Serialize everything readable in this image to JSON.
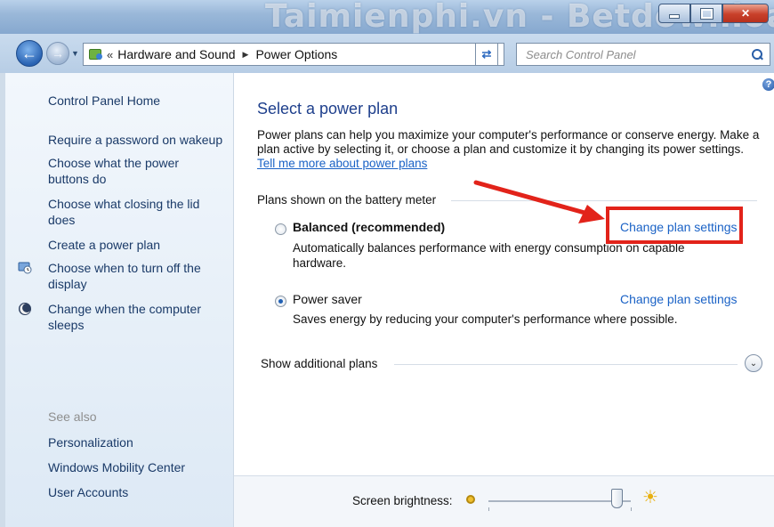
{
  "watermark": "Taimienphi.vn - Betdownload",
  "window_controls": {
    "minimize": "–",
    "maximize": "□",
    "close": "✕"
  },
  "nav": {
    "back_icon": "back-arrow-icon",
    "forward_icon": "forward-arrow-icon",
    "breadcrumb_prefix": "«",
    "breadcrumb": [
      "Hardware and Sound",
      "Power Options"
    ],
    "refresh_icon": "refresh-icon",
    "search_placeholder": "Search Control Panel"
  },
  "sidebar": {
    "home": "Control Panel Home",
    "links": [
      "Require a password on wakeup",
      "Choose what the power buttons do",
      "Choose what closing the lid does",
      "Create a power plan",
      "Choose when to turn off the display",
      "Change when the computer sleeps"
    ],
    "see_also_label": "See also",
    "see_also": [
      "Personalization",
      "Windows Mobility Center",
      "User Accounts"
    ]
  },
  "main": {
    "title": "Select a power plan",
    "description": "Power plans can help you maximize your computer's performance or conserve energy. Make a plan active by selecting it, or choose a plan and customize it by changing its power settings.",
    "learn_more_link": "Tell me more about power plans",
    "group_label": "Plans shown on the battery meter",
    "plans": [
      {
        "name": "Balanced (recommended)",
        "description": "Automatically balances performance with energy consumption on capable hardware.",
        "link": "Change plan settings",
        "selected": false
      },
      {
        "name": "Power saver",
        "description": "Saves energy by reducing your computer's performance where possible.",
        "link": "Change plan settings",
        "selected": true
      }
    ],
    "show_additional": "Show additional plans",
    "help_icon": "?"
  },
  "bottom": {
    "brightness_label": "Screen brightness:",
    "brightness_level": 0.9
  },
  "colors": {
    "link": "#1a62c6",
    "title": "#1e3f8c",
    "annotation": "#e2231a"
  }
}
